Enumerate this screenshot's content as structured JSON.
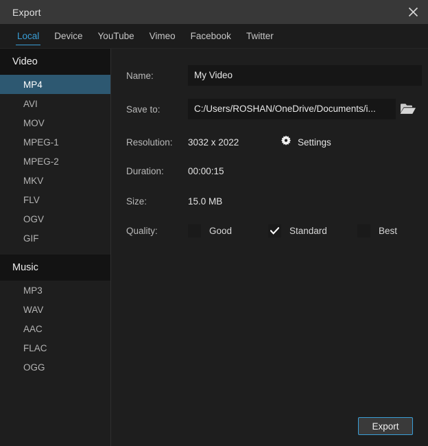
{
  "window": {
    "title": "Export",
    "close_icon": "close-icon"
  },
  "tabs": [
    {
      "label": "Local",
      "active": true
    },
    {
      "label": "Device",
      "active": false
    },
    {
      "label": "YouTube",
      "active": false
    },
    {
      "label": "Vimeo",
      "active": false
    },
    {
      "label": "Facebook",
      "active": false
    },
    {
      "label": "Twitter",
      "active": false
    }
  ],
  "sidebar": {
    "groups": [
      {
        "title": "Video",
        "items": [
          {
            "label": "MP4",
            "selected": true
          },
          {
            "label": "AVI",
            "selected": false
          },
          {
            "label": "MOV",
            "selected": false
          },
          {
            "label": "MPEG-1",
            "selected": false
          },
          {
            "label": "MPEG-2",
            "selected": false
          },
          {
            "label": "MKV",
            "selected": false
          },
          {
            "label": "FLV",
            "selected": false
          },
          {
            "label": "OGV",
            "selected": false
          },
          {
            "label": "GIF",
            "selected": false
          }
        ]
      },
      {
        "title": "Music",
        "items": [
          {
            "label": "MP3",
            "selected": false
          },
          {
            "label": "WAV",
            "selected": false
          },
          {
            "label": "AAC",
            "selected": false
          },
          {
            "label": "FLAC",
            "selected": false
          },
          {
            "label": "OGG",
            "selected": false
          }
        ]
      }
    ]
  },
  "form": {
    "name": {
      "label": "Name:",
      "value": "My Video"
    },
    "save_to": {
      "label": "Save to:",
      "value": "C:/Users/ROSHAN/OneDrive/Documents/i...",
      "browse_icon": "folder-icon"
    },
    "resolution": {
      "label": "Resolution:",
      "value": "3032 x 2022"
    },
    "settings": {
      "label": "Settings",
      "icon": "gear-icon"
    },
    "duration": {
      "label": "Duration:",
      "value": "00:00:15"
    },
    "size": {
      "label": "Size:",
      "value": "15.0 MB"
    },
    "quality": {
      "label": "Quality:",
      "options": [
        {
          "label": "Good",
          "checked": false
        },
        {
          "label": "Standard",
          "checked": true
        },
        {
          "label": "Best",
          "checked": false
        }
      ]
    }
  },
  "footer": {
    "export_label": "Export"
  },
  "colors": {
    "accent": "#3a9fd8",
    "selection": "#2d5871",
    "titlebar": "#383838",
    "panel": "#1e1e1e",
    "input": "#161616"
  }
}
